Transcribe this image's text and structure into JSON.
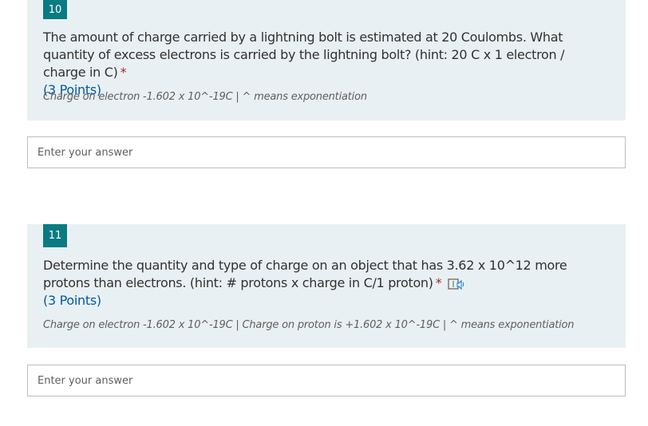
{
  "questions": [
    {
      "number": "10",
      "text": "The amount of charge carried by a lightning bolt is estimated at 20 Coulombs. What quantity of excess electrons is carried by the lightning bolt? (hint: 20 C  x 1 electron / charge in C)",
      "required_mark": "*",
      "points": "(3 Points)",
      "subtitle": "Charge on electron -1.602 x 10^-19C  |  ^ means exponentiation",
      "answer_placeholder": "Enter your answer"
    },
    {
      "number": "11",
      "text": "Determine the quantity and type of charge on an object that has 3.62 x 10^12 more protons than electrons. (hint: # protons x charge in C/1 proton)",
      "required_mark": "*",
      "icon": "immersive-reader-icon",
      "points": "(3 Points)",
      "subtitle": "Charge on electron -1.602 x 10^-19C  |  Charge on proton is +1.602 x 10^-19C  |  ^ means exponentiation",
      "answer_placeholder": "Enter your answer"
    }
  ],
  "colors": {
    "accent": "#0a7b83",
    "question_background": "#e9f0f3",
    "required": "#a4262c",
    "points": "#005a9e"
  }
}
